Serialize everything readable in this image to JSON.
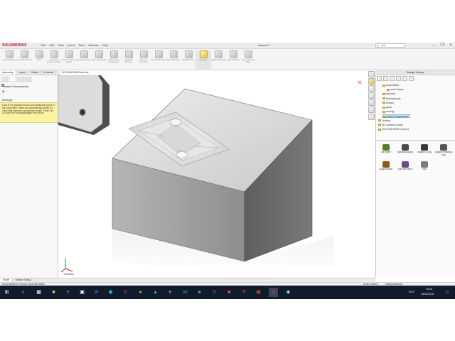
{
  "app": {
    "logo": "SOLIDWORKS",
    "title": "Assem9 *",
    "menu": [
      "File",
      "Edit",
      "View",
      "Insert",
      "Tools",
      "Window",
      "Help"
    ],
    "search_placeholder": "cme"
  },
  "toolbar": {
    "tools": [
      {
        "label": "Edit Component",
        "icon": "edit-component-icon"
      },
      {
        "label": "Insert Components",
        "icon": "insert-components-icon"
      },
      {
        "label": "Mate",
        "icon": "mate-icon"
      },
      {
        "label": "Component Preview Window",
        "icon": "preview-window-icon"
      },
      {
        "label": "Linear Component Pattern",
        "icon": "pattern-icon"
      },
      {
        "label": "Smart Fasteners",
        "icon": "fastener-icon"
      },
      {
        "label": "Move Component",
        "icon": "move-component-icon"
      },
      {
        "label": "Show Hidden Components",
        "icon": "show-hidden-icon"
      },
      {
        "label": "Assembly Features",
        "icon": "assembly-features-icon"
      },
      {
        "label": "Reference Geometry",
        "icon": "reference-geometry-icon"
      },
      {
        "label": "New Motion Study",
        "icon": "motion-study-icon"
      },
      {
        "label": "Bill of Materials",
        "icon": "bom-icon"
      },
      {
        "label": "Exploded View",
        "icon": "exploded-view-icon"
      },
      {
        "label": "Instant3D",
        "icon": "instant3d-icon"
      },
      {
        "label": "Update Speedpak",
        "icon": "speedpak-icon"
      },
      {
        "label": "Take Snapshot",
        "icon": "snapshot-icon"
      },
      {
        "label": "Large Assembly Mode",
        "icon": "large-assembly-icon"
      }
    ],
    "active_tool": "Instant3D"
  },
  "tabs": [
    "Assembly",
    "Layout",
    "Sketch",
    "Evaluate"
  ],
  "addins_tab": "SOLIDWORKS Add-Ins",
  "property_manager": {
    "title": "Insert Components",
    "message_label": "Message",
    "message": "Click in the graphics area to add additional copies of the component. Mates are automatically added if a valid mate reference combination exists. Press Esc or close the PropertyManager when done."
  },
  "viewport": {
    "view_label": "*Trimetric"
  },
  "design_library": {
    "title": "Design Library",
    "tree": [
      {
        "label": "assemblies",
        "level": 1
      },
      {
        "label": "mold bases",
        "level": 2
      },
      {
        "label": "features",
        "level": 1
      },
      {
        "label": "forming tools",
        "level": 1
      },
      {
        "label": "motion",
        "level": 1
      },
      {
        "label": "parts",
        "level": 1
      },
      {
        "label": "routing",
        "level": 1
      },
      {
        "label": "smart components",
        "level": 1,
        "selected": true
      },
      {
        "label": "Toolbox",
        "level": 0
      },
      {
        "label": "3D ContentCentral",
        "level": 0
      },
      {
        "label": "SOLIDWORKS Content",
        "level": 0
      }
    ],
    "components": [
      {
        "label": "die insert",
        "color": "#5a7a2a"
      },
      {
        "label": "hydraulic clamp",
        "color": "#4a4a4a"
      },
      {
        "label": "sample o-ring",
        "color": "#3a3a3a"
      },
      {
        "label": "sample retaining ring",
        "color": "#555555"
      },
      {
        "label": "snap bumper",
        "color": "#8a5a1a"
      },
      {
        "label": "spin lite insert",
        "color": "#6a4a8a"
      },
      {
        "label": "Null",
        "color": "#7a7a7a"
      }
    ]
  },
  "bottom_tabs": [
    "Model",
    "Motion Study 1"
  ],
  "status": {
    "left": "SOLIDWORKS Premium 2018 x64 Edition",
    "under_defined": "Under Defined",
    "editing": "Editing Assembly"
  },
  "taskbar": {
    "time": "15:45",
    "date": "18/05/2018",
    "language": "ENG"
  },
  "colors": {
    "accent": "#c8102e",
    "message_bg": "#fbf3a0",
    "taskbar": "#101c2b"
  }
}
